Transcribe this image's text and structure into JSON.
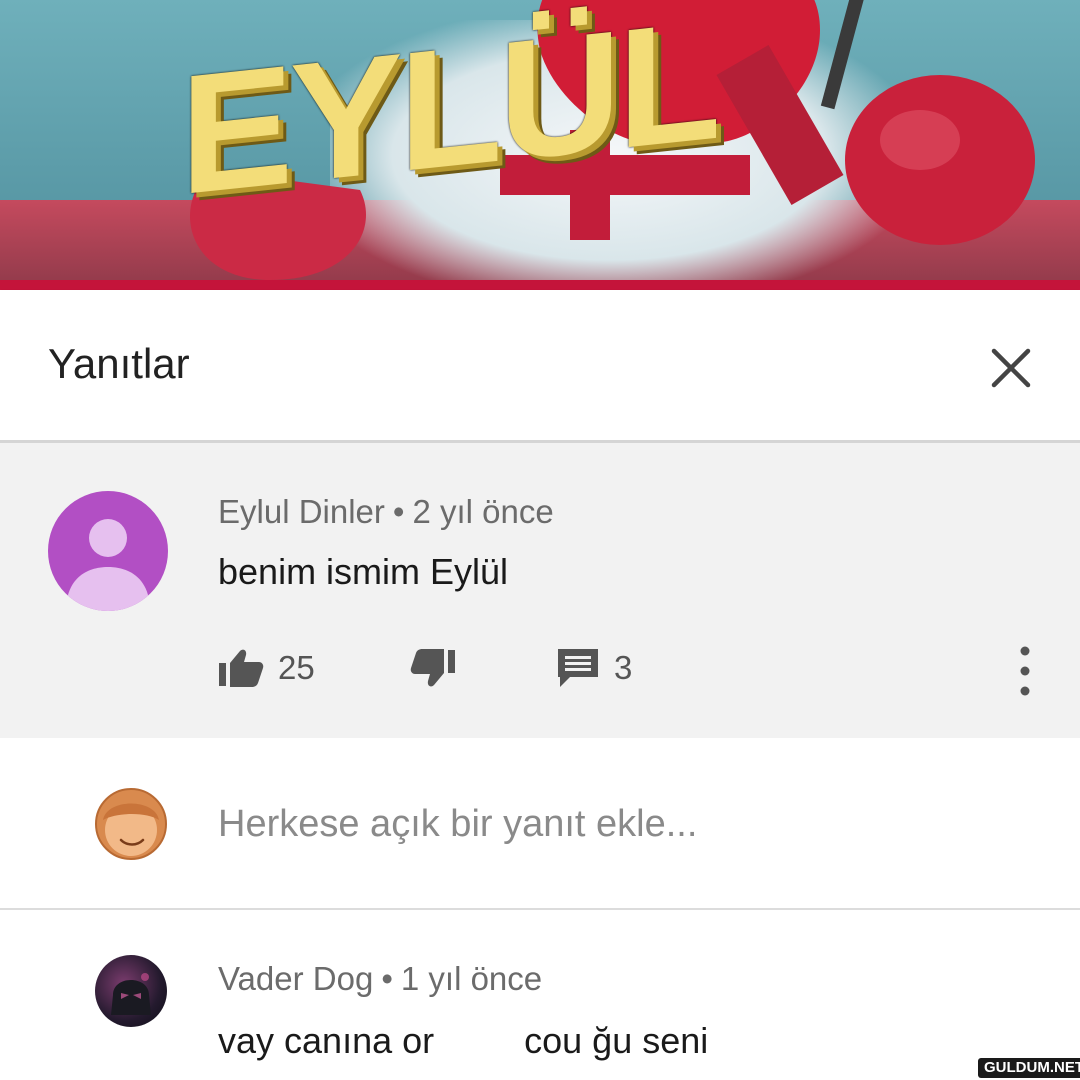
{
  "video": {
    "thumbnail_text": "EYLÜL"
  },
  "sheet": {
    "title": "Yanıtlar",
    "close_icon": "close-icon"
  },
  "comment": {
    "author": "Eylul Dinler",
    "separator": "•",
    "time": "2 yıl önce",
    "text": "benim ismim Eylül",
    "likes": "25",
    "replies": "3",
    "avatar_color": "#b24fc4"
  },
  "reply_box": {
    "placeholder": "Herkese açık bir yanıt ekle..."
  },
  "reply": {
    "author": "Vader Dog",
    "separator": "•",
    "time": "1 yıl önce",
    "text": "vay canına or         cou ğu seni"
  },
  "watermark": "GULDUM.NET"
}
